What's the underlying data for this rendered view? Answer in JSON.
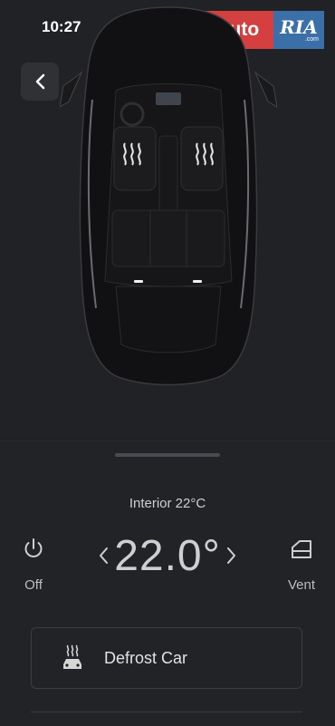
{
  "status": {
    "time": "10:27"
  },
  "watermark": {
    "left": "auto",
    "right": "RIA",
    "suffix": ".com"
  },
  "climate": {
    "interior_label": "Interior 22°C",
    "target_temp": "22.0°",
    "power_label": "Off",
    "vent_label": "Vent",
    "defrost_label": "Defrost Car"
  },
  "icons": [
    "back-icon",
    "seat-heat-icon",
    "power-icon",
    "window-vent-icon",
    "chevron-left-icon",
    "chevron-right-icon",
    "defrost-car-icon"
  ]
}
